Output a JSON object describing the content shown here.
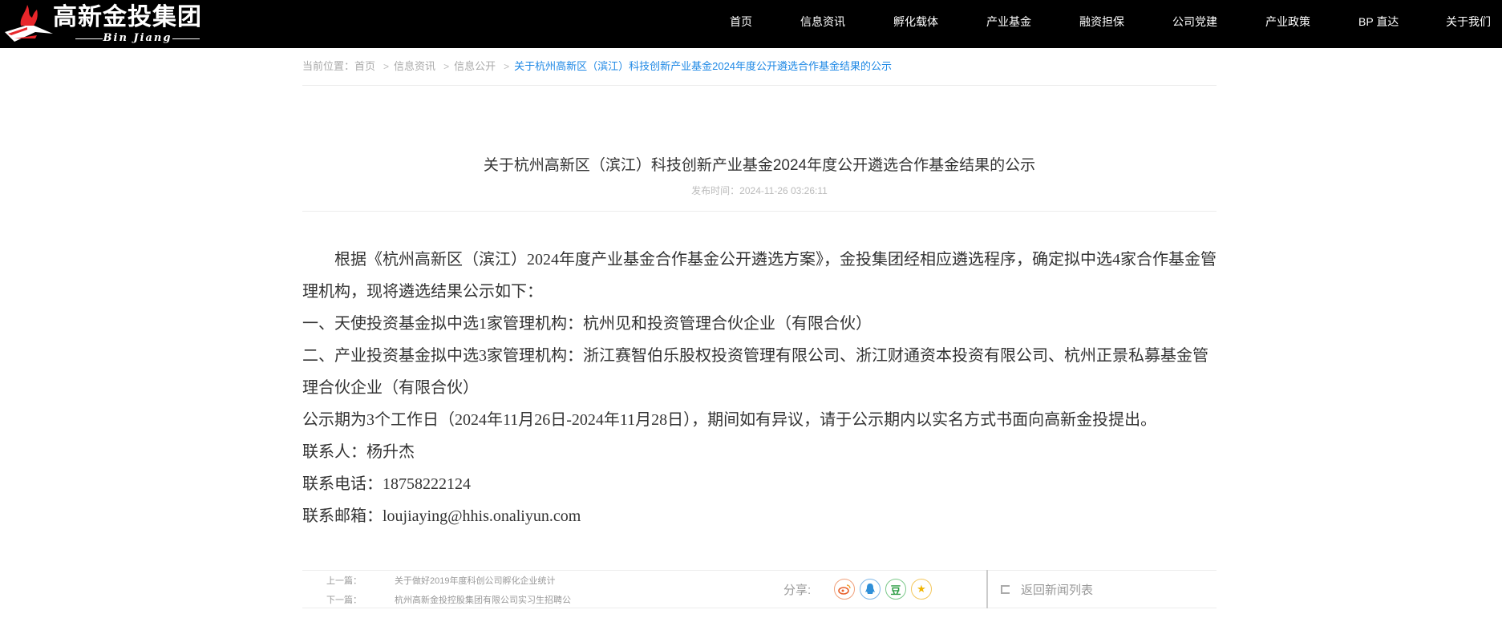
{
  "header": {
    "logo_title": "高新金投集团",
    "logo_subtitle": "Bin Jiang",
    "nav": [
      "首页",
      "信息资讯",
      "孵化载体",
      "产业基金",
      "融资担保",
      "公司党建",
      "产业政策",
      "BP 直达",
      "关于我们"
    ]
  },
  "breadcrumb": {
    "prefix": "当前位置：",
    "items": [
      "首页",
      "信息资讯",
      "信息公开"
    ],
    "current": "关于杭州高新区（滨江）科技创新产业基金2024年度公开遴选合作基金结果的公示"
  },
  "article": {
    "title": "关于杭州高新区（滨江）科技创新产业基金2024年度公开遴选合作基金结果的公示",
    "time_label": "发布时间：",
    "time": "2024-11-26 03:26:11",
    "paragraphs": [
      "根据《杭州高新区（滨江）2024年度产业基金合作基金公开遴选方案》，金投集团经相应遴选程序，确定拟中选4家合作基金管理机构，现将遴选结果公示如下：",
      "一、天使投资基金拟中选1家管理机构：杭州见和投资管理合伙企业（有限合伙）",
      "二、产业投资基金拟中选3家管理机构：浙江赛智伯乐股权投资管理有限公司、浙江财通资本投资有限公司、杭州正景私募基金管理合伙企业（有限合伙）",
      "公示期为3个工作日（2024年11月26日-2024年11月28日），期间如有异议，请于公示期内以实名方式书面向高新金投提出。",
      "联系人：杨升杰",
      "联系电话：18758222124",
      "联系邮箱：loujiaying@hhis.onaliyun.com"
    ]
  },
  "footer": {
    "prev_label": "上一篇：",
    "prev_title": "关于做好2019年度科创公司孵化企业统计",
    "next_label": "下一篇：",
    "next_title": "杭州高新金投控股集团有限公司实习生招聘公",
    "share_label": "分享:",
    "share_icons": [
      "weibo-icon",
      "qq-icon",
      "douban-icon",
      "qzone-icon"
    ],
    "back_label": "返回新闻列表"
  },
  "colors": {
    "header_bg": "#000000",
    "link_blue": "#1e88e5",
    "logo_red": "#e8262a"
  }
}
